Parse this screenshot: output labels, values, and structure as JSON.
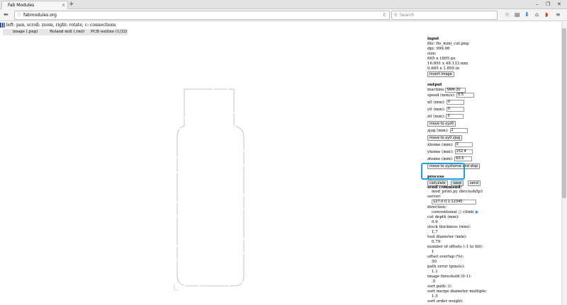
{
  "browser": {
    "tab_title": "Fab Modules",
    "tab_close": "×",
    "new_tab": "+",
    "url": "fabmodules.org",
    "search_placeholder": "Search",
    "reload_icon": "C"
  },
  "page": {
    "mods_hint": "left: pan, scroll: zoom, right: rotate, c: connections",
    "menus": [
      "image (.png)",
      "Roland mill (.rml)",
      "PCB outline (1/32)"
    ]
  },
  "input": {
    "heading": "input",
    "file": "file: fts_mini_cut.png",
    "dpi": "dpi: 999.96",
    "size_label": "size:",
    "size_px": "665 x 1895 px",
    "size_mm": "16.891 x 48.133 mm",
    "size_in": "0.665 x 1.895 in",
    "invert_label": "invert image"
  },
  "output": {
    "heading": "output",
    "machine_label": "machine",
    "machine_value": "SRM-20",
    "speed_label": "speed (mm/s):",
    "speed_value": "0.5",
    "x0_label": "x0 (mm):",
    "x0_value": "0",
    "y0_label": "y0 (mm):",
    "y0_value": "0",
    "z0_label": "z0 (mm):",
    "z0_value": "0",
    "move_xyz0": "move to xyz0",
    "zjog_label": "zjog (mm):",
    "zjog_value": "2",
    "move_xy0": "move to xy0 zjog",
    "xhome_label": "xhome (mm):",
    "xhome_value": "0",
    "yhome_label": "yhome (mm):",
    "yhome_value": "152.4",
    "zhome_label": "zhome (mm):",
    "zhome_value": "60.5",
    "move_home": "move to xyzhome and stop"
  },
  "process": {
    "heading": "process",
    "calculate": "calculate",
    "save": "save",
    "send": "send",
    "send_command_label": "send command:",
    "send_command_value": "mod_print.py /dev/usb/lp1",
    "server_label": "server:",
    "server_value": "127.0.0.1:12345",
    "direction_label": "direction:",
    "conventional": "conventional",
    "climb": "climb",
    "cut_depth_label": "cut depth (mm):",
    "cut_depth_value": "0.6",
    "stock_label": "stock thickness (mm):",
    "stock_value": "1.7",
    "tool_label": "tool diameter (mm):",
    "tool_value": "0.79",
    "offsets_label": "number of offsets (-1 to fill):",
    "offsets_value": "1",
    "overlap_label": "offset overlap (%):",
    "overlap_value": "50",
    "path_error_label": "path error (pixels):",
    "path_error_value": "1.1",
    "threshold_label": "image threshold (0-1):",
    "threshold_value": ".5",
    "sort_label": "sort path:",
    "merge_label": "sort merge diameter multiple:",
    "merge_value": "1.5",
    "order_label": "sort order weight:"
  },
  "colors": {
    "highlight": "#1ba1e2",
    "chrome": "#e3e3e3"
  }
}
